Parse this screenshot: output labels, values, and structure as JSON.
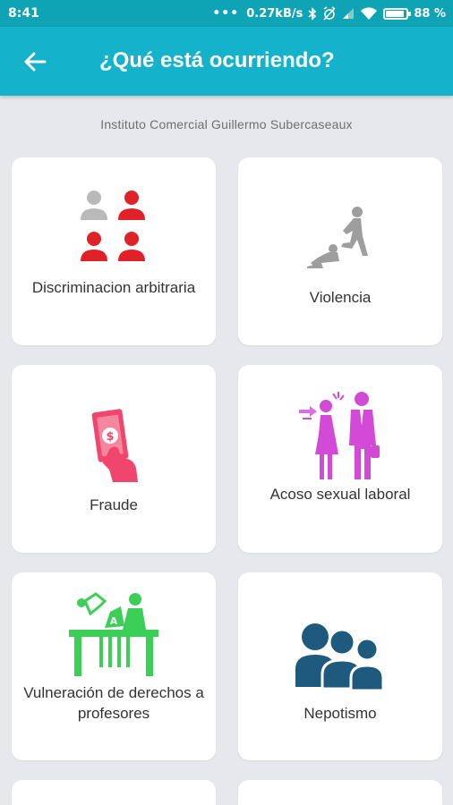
{
  "status_bar": {
    "time": "8:41",
    "network_speed": "0.27kB/s",
    "battery_percent": "88 %",
    "battery_level": 0.88,
    "icons": [
      "more-dots-icon",
      "bluetooth-icon",
      "alarm-off-icon",
      "signal-icon",
      "wifi-icon",
      "battery-icon"
    ]
  },
  "app_bar": {
    "back_icon": "arrow-left-icon",
    "title": "¿Qué está ocurriendo?",
    "background": "#15b3cb"
  },
  "subtitle": "Instituto Comercial Guillermo Subercaseaux",
  "categories": [
    {
      "label": "Discriminacion arbitraria",
      "icon": "people-group-icon",
      "color": "#e02128"
    },
    {
      "label": "Violencia",
      "icon": "violence-icon",
      "color": "#9e9e9e"
    },
    {
      "label": "Fraude",
      "icon": "fraud-money-hand-icon",
      "color": "#f0466e"
    },
    {
      "label": "Acoso sexual laboral",
      "icon": "harassment-icon",
      "color": "#d24ad6"
    },
    {
      "label": "Vulneración de derechos a profesores",
      "icon": "teacher-desk-icon",
      "color": "#3ccf57"
    },
    {
      "label": "Nepotismo",
      "icon": "nepotism-group-icon",
      "color": "#1d5a7d"
    }
  ]
}
